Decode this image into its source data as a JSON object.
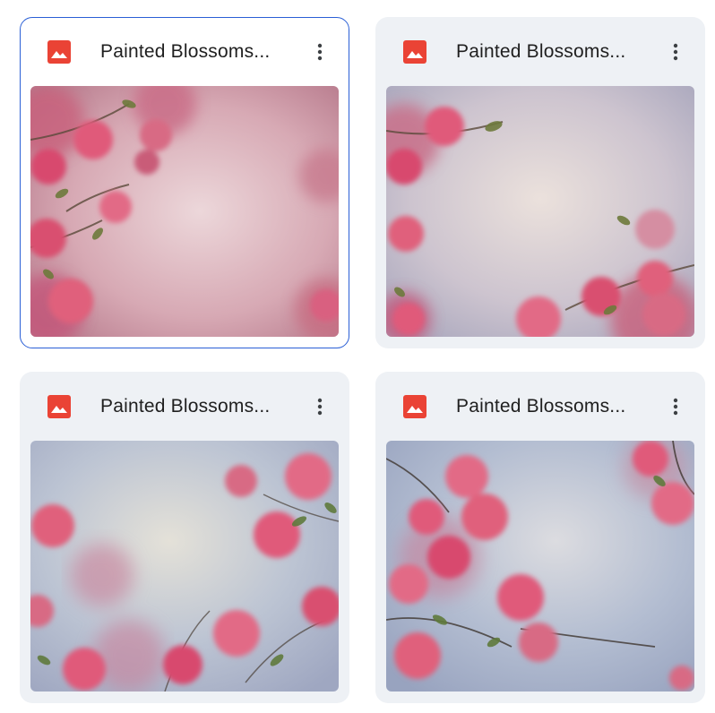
{
  "files": [
    {
      "title": "Painted Blossoms...",
      "selected": true,
      "type_icon": "image-file-icon",
      "menu_icon": "more-vert-icon"
    },
    {
      "title": "Painted Blossoms...",
      "selected": false,
      "type_icon": "image-file-icon",
      "menu_icon": "more-vert-icon"
    },
    {
      "title": "Painted Blossoms...",
      "selected": false,
      "type_icon": "image-file-icon",
      "menu_icon": "more-vert-icon"
    },
    {
      "title": "Painted Blossoms...",
      "selected": false,
      "type_icon": "image-file-icon",
      "menu_icon": "more-vert-icon"
    }
  ],
  "colors": {
    "card_bg": "#eef1f5",
    "selected_border": "#2a5fd6",
    "image_icon_red": "#ea4335",
    "title_text": "#1f1f1f"
  }
}
